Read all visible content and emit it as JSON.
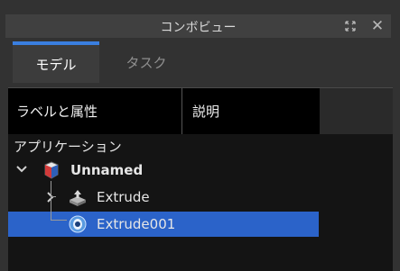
{
  "window": {
    "title": "コンボビュー"
  },
  "tabs": [
    {
      "label": "モデル",
      "active": true
    },
    {
      "label": "タスク",
      "active": false
    }
  ],
  "columns": [
    "ラベルと属性",
    "説明"
  ],
  "tree": {
    "root_label": "アプリケーション",
    "document": {
      "label": "Unnamed",
      "icon": "document-icon"
    },
    "items": [
      {
        "label": "Extrude",
        "icon": "extrude-icon",
        "selected": false
      },
      {
        "label": "Extrude001",
        "icon": "eye-icon",
        "selected": true
      }
    ]
  },
  "colors": {
    "accent": "#3a7fe0",
    "selection": "#2b63c9"
  }
}
